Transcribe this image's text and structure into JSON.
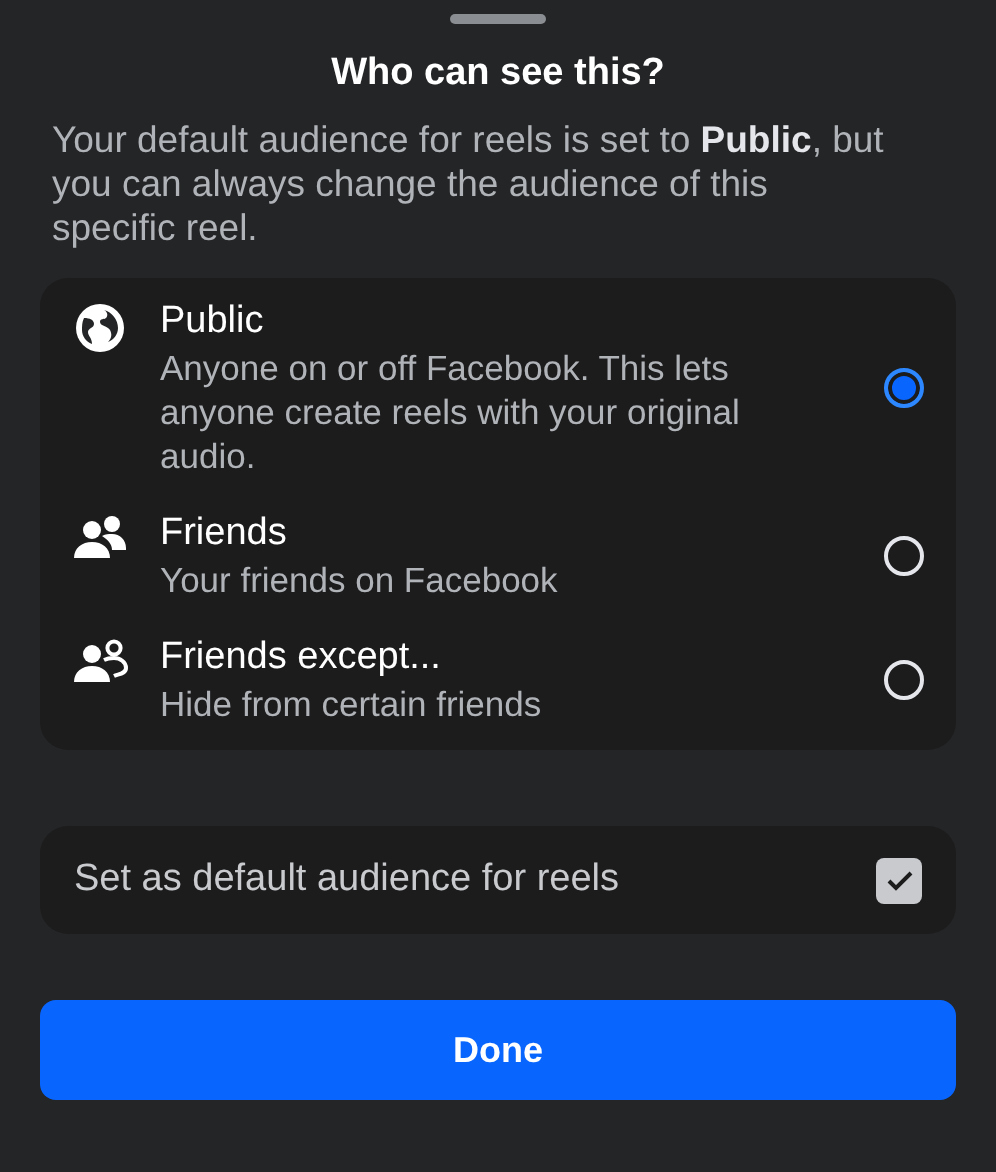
{
  "title": "Who can see this?",
  "description": "Your default audience for reels is set to **Public**, but you can always change the audience of this specific reel.",
  "options": [
    {
      "label": "Public",
      "detail": "Anyone on or off Facebook. This lets anyone create reels with your original audio.",
      "selected": true
    },
    {
      "label": "Friends",
      "detail": "Your friends on Facebook",
      "selected": false
    },
    {
      "label": "Friends except...",
      "detail": "Hide from certain friends",
      "selected": false
    }
  ],
  "default_setting": {
    "label": "Set as default audience for reels",
    "checked": true
  },
  "button": "Done"
}
